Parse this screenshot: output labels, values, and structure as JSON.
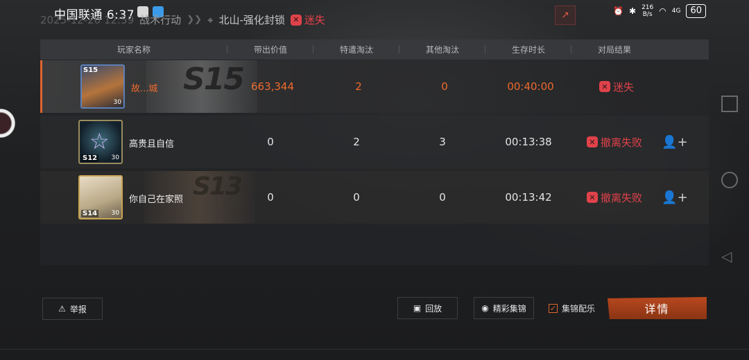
{
  "status_bar": {
    "carrier_time": "中国联通 6:37",
    "net_speed_value": "216",
    "net_speed_unit": "B/s",
    "signal": "4G",
    "battery": "60"
  },
  "header": {
    "date": "2025-12-20 12:59",
    "mode": "战术行动",
    "map": "北山-强化封锁",
    "result": "迷失"
  },
  "table": {
    "columns": [
      "玩家名称",
      "带出价值",
      "特遣淘汰",
      "其他淘汰",
      "生存时长",
      "对局结果"
    ],
    "rows": [
      {
        "season_top": "S15",
        "level": "30",
        "name": "故...城",
        "banner": "S15",
        "value": "663,344",
        "special_kills": "2",
        "other_kills": "0",
        "survival": "00:40:00",
        "result": "迷失"
      },
      {
        "season": "S12",
        "level": "30",
        "name": "高贵且自信",
        "value": "0",
        "special_kills": "2",
        "other_kills": "3",
        "survival": "00:13:38",
        "result": "撤离失败"
      },
      {
        "season": "S14",
        "level": "30",
        "name": "你自己在家照",
        "banner": "S13",
        "value": "0",
        "special_kills": "0",
        "other_kills": "0",
        "survival": "00:13:42",
        "result": "撤离失败"
      }
    ]
  },
  "buttons": {
    "report": "举报",
    "replay": "回放",
    "highlights": "精彩集锦",
    "music": "集锦配乐",
    "detail": "详情"
  },
  "colors": {
    "accent_orange": "#ef6a2c",
    "fail_red": "#e0424a",
    "detail_button": "#a8401a"
  }
}
